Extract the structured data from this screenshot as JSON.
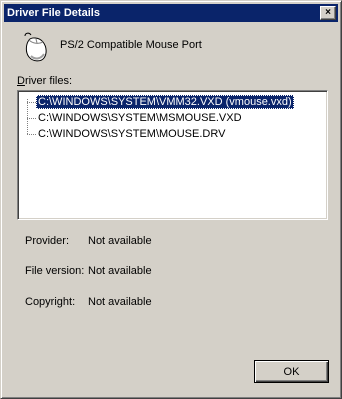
{
  "window": {
    "title": "Driver File Details"
  },
  "device": {
    "icon": "mouse-icon",
    "name": "PS/2 Compatible Mouse Port"
  },
  "files": {
    "label_prefix": "D",
    "label_rest": "river files:",
    "items": [
      {
        "path": "C:\\WINDOWS\\SYSTEM\\VMM32.VXD (vmouse.vxd)",
        "selected": true
      },
      {
        "path": "C:\\WINDOWS\\SYSTEM\\MSMOUSE.VXD",
        "selected": false
      },
      {
        "path": "C:\\WINDOWS\\SYSTEM\\MOUSE.DRV",
        "selected": false
      }
    ]
  },
  "details": {
    "provider_label": "Provider:",
    "provider_value": "Not available",
    "version_label": "File version:",
    "version_value": "Not available",
    "copyright_label": "Copyright:",
    "copyright_value": "Not available"
  },
  "buttons": {
    "ok": "OK",
    "close": "×"
  },
  "colors": {
    "titlebar": "#0a246a",
    "face": "#d4d0c8",
    "selection": "#0a246a"
  }
}
